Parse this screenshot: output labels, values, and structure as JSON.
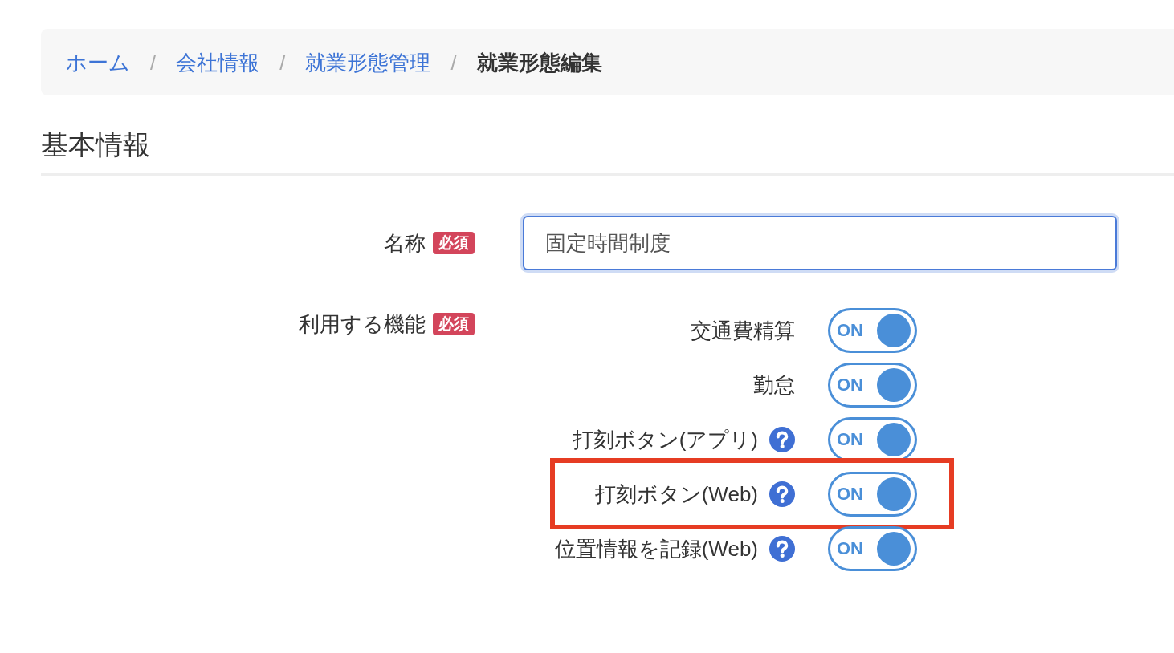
{
  "breadcrumb": {
    "items": [
      {
        "label": "ホーム",
        "current": false
      },
      {
        "label": "会社情報",
        "current": false
      },
      {
        "label": "就業形態管理",
        "current": false
      },
      {
        "label": "就業形態編集",
        "current": true
      }
    ],
    "separators": [
      "/",
      "/",
      "/"
    ]
  },
  "section": {
    "title": "基本情報"
  },
  "form": {
    "name_field": {
      "label": "名称",
      "required_badge": "必須",
      "value": "固定時間制度",
      "focused": true
    },
    "features": {
      "label": "利用する機能",
      "required_badge": "必須",
      "items": [
        {
          "label": "交通費精算",
          "help": false,
          "on": true,
          "switch_text": "ON",
          "highlighted": false
        },
        {
          "label": "勤怠",
          "help": false,
          "on": true,
          "switch_text": "ON",
          "highlighted": false
        },
        {
          "label": "打刻ボタン(アプリ)",
          "help": true,
          "on": true,
          "switch_text": "ON",
          "highlighted": false
        },
        {
          "label": "打刻ボタン(Web)",
          "help": true,
          "on": true,
          "switch_text": "ON",
          "highlighted": true
        },
        {
          "label": "位置情報を記録(Web)",
          "help": true,
          "on": true,
          "switch_text": "ON",
          "highlighted": false
        }
      ]
    }
  }
}
